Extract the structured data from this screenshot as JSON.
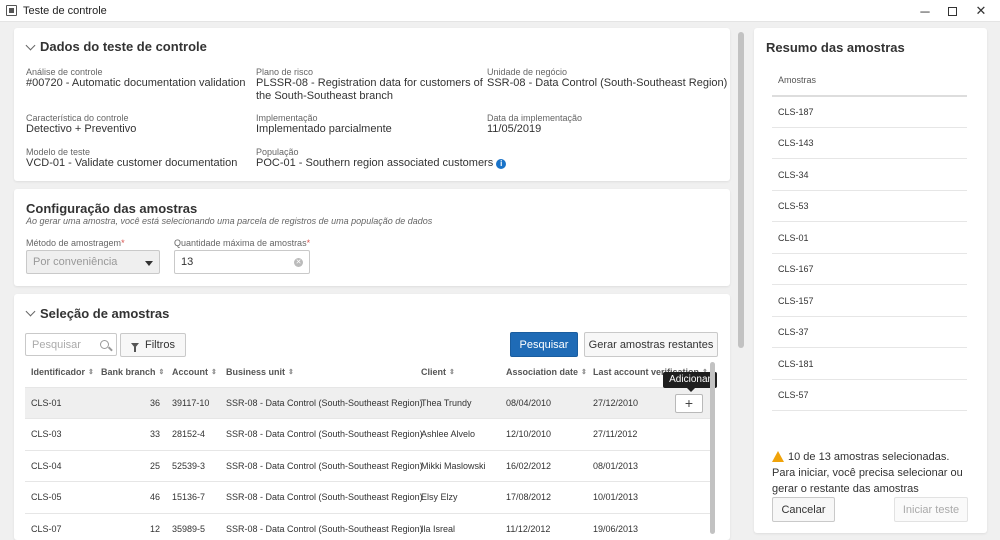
{
  "window": {
    "title": "Teste de controle",
    "controls": {
      "minimize": "─",
      "close": "✕"
    }
  },
  "dados": {
    "title": "Dados do teste de controle",
    "fields": {
      "analise": {
        "label": "Análise de controle",
        "value": "#00720 - Automatic documentation validation"
      },
      "plano": {
        "label": "Plano de risco",
        "value_line1": "PLSSR-08 - Registration data for customers of",
        "value_line2": "the South-Southeast branch"
      },
      "unidade": {
        "label": "Unidade de negócio",
        "value": "SSR-08 - Data Control (South-Southeast Region)"
      },
      "caracteristica": {
        "label": "Característica do controle",
        "value": "Detectivo + Preventivo"
      },
      "implementacao": {
        "label": "Implementação",
        "value": "Implementado parcialmente"
      },
      "data_impl": {
        "label": "Data da implementação",
        "value": "11/05/2019"
      },
      "modelo": {
        "label": "Modelo de teste",
        "value": "VCD-01 - Validate customer documentation"
      },
      "populacao": {
        "label": "População",
        "value": "POC-01 - Southern region associated customers"
      }
    }
  },
  "config": {
    "title": "Configuração das amostras",
    "subtitle": "Ao gerar uma amostra, você está selecionando uma parcela de registros de uma população de dados",
    "metodo_label": "Método de amostragem",
    "metodo_value": "Por conveniência",
    "quantidade_label": "Quantidade máxima de amostras",
    "quantidade_value": "13",
    "required_mark": "*"
  },
  "selecao": {
    "title": "Seleção de amostras",
    "search_placeholder": "Pesquisar",
    "filtros_label": "Filtros",
    "pesquisar_label": "Pesquisar",
    "gerar_label": "Gerar amostras restantes",
    "tooltip": "Adicionar",
    "add_symbol": "+",
    "sort_symbol": "⇕",
    "columns": [
      "Identificador",
      "Bank branch",
      "Account",
      "Business unit",
      "Client",
      "Association date",
      "Last account verification"
    ],
    "rows": [
      {
        "id": "CLS-01",
        "branch": "36",
        "account": "39117-10",
        "unit": "SSR-08 - Data Control (South-Southeast Region)",
        "client": "Thea Trundy",
        "assoc": "08/04/2010",
        "last": "27/12/2010"
      },
      {
        "id": "CLS-03",
        "branch": "33",
        "account": "28152-4",
        "unit": "SSR-08 - Data Control (South-Southeast Region)",
        "client": "Ashlee Alvelo",
        "assoc": "12/10/2010",
        "last": "27/11/2012"
      },
      {
        "id": "CLS-04",
        "branch": "25",
        "account": "52539-3",
        "unit": "SSR-08 - Data Control (South-Southeast Region)",
        "client": "Mikki Maslowski",
        "assoc": "16/02/2012",
        "last": "08/01/2013"
      },
      {
        "id": "CLS-05",
        "branch": "46",
        "account": "15136-7",
        "unit": "SSR-08 - Data Control (South-Southeast Region)",
        "client": "Elsy Elzy",
        "assoc": "17/08/2012",
        "last": "10/01/2013"
      },
      {
        "id": "CLS-07",
        "branch": "12",
        "account": "35989-5",
        "unit": "SSR-08 - Data Control (South-Southeast Region)",
        "client": "Ila Isreal",
        "assoc": "11/12/2012",
        "last": "19/06/2013"
      }
    ]
  },
  "resumo": {
    "title": "Resumo das amostras",
    "column": "Amostras",
    "items": [
      "CLS-187",
      "CLS-143",
      "CLS-34",
      "CLS-53",
      "CLS-01",
      "CLS-167",
      "CLS-157",
      "CLS-37",
      "CLS-181",
      "CLS-57"
    ],
    "warning": "10 de 13 amostras selecionadas. Para iniciar, você precisa selecionar ou gerar o restante das amostras",
    "cancelar_label": "Cancelar",
    "iniciar_label": "Iniciar teste"
  }
}
